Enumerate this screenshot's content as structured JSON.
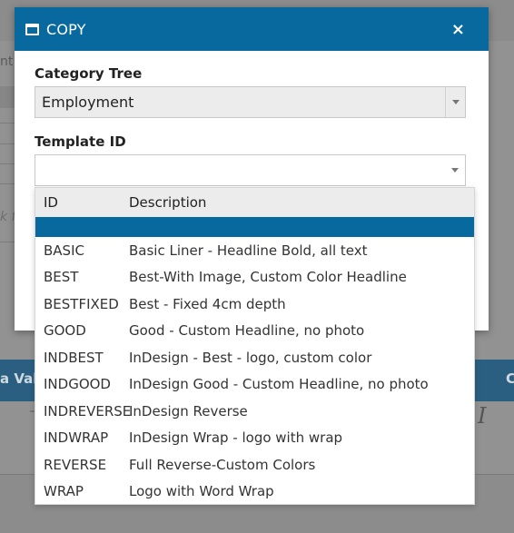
{
  "background": {
    "left_fragment": "nt",
    "italic_fragment": "k f",
    "bar_left_text": "a Val",
    "bar_right_text": "C",
    "italic_icon_glyph": "I"
  },
  "modal": {
    "title": "COPY",
    "close_glyph": "×",
    "category_tree": {
      "label": "Category Tree",
      "value": "Employment"
    },
    "template_id": {
      "label": "Template ID",
      "value": ""
    }
  },
  "dropdown": {
    "columns": {
      "id": "ID",
      "description": "Description"
    },
    "rows": [
      {
        "id": "BASIC",
        "description": "Basic Liner - Headline Bold, all text"
      },
      {
        "id": "BEST",
        "description": "Best-With Image, Custom Color Headline"
      },
      {
        "id": "BESTFIXED",
        "description": "Best - Fixed 4cm depth"
      },
      {
        "id": "GOOD",
        "description": "Good - Custom Headline, no photo"
      },
      {
        "id": "INDBEST",
        "description": "InDesign - Best - logo, custom color"
      },
      {
        "id": "INDGOOD",
        "description": "InDesign Good - Custom Headline, no photo"
      },
      {
        "id": "INDREVERSE",
        "description": "InDesign Reverse"
      },
      {
        "id": "INDWRAP",
        "description": "InDesign Wrap - logo with wrap"
      },
      {
        "id": "REVERSE",
        "description": "Full Reverse-Custom Colors"
      },
      {
        "id": "WRAP",
        "description": "Logo with Word Wrap"
      }
    ]
  },
  "colors": {
    "header_blue": "#07699e",
    "overlay_gray": "#8c8c8c"
  }
}
